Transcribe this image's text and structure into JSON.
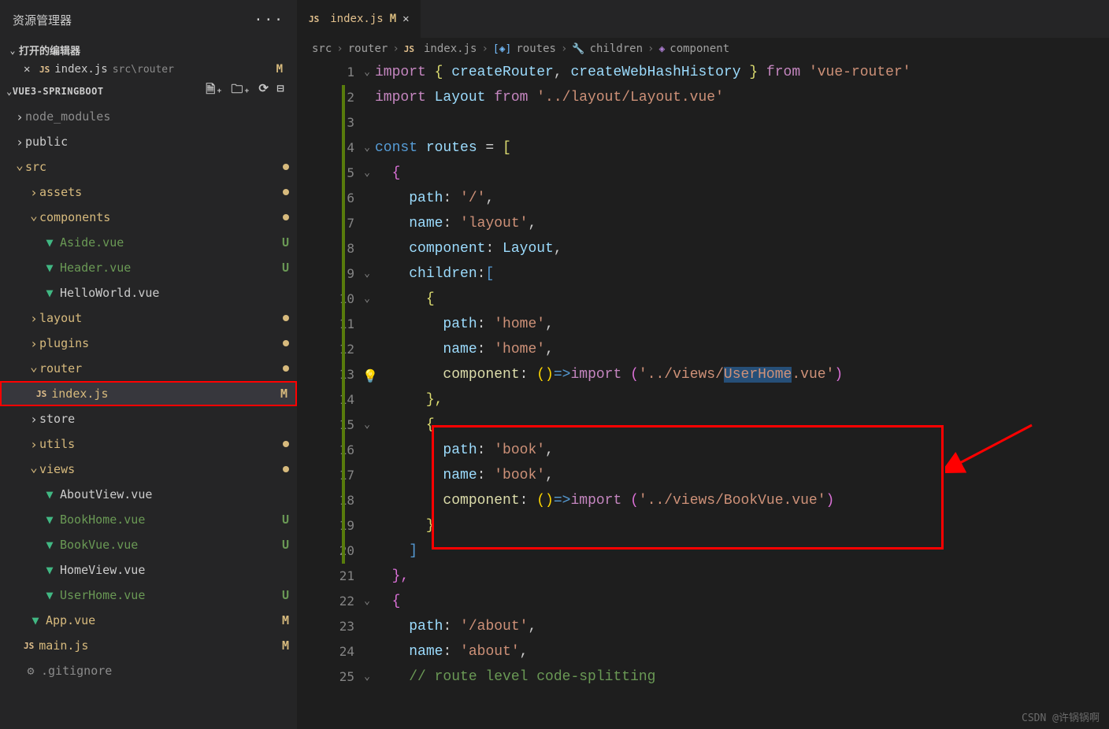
{
  "explorer": {
    "title": "资源管理器",
    "open_editors_label": "打开的编辑器",
    "open_editor_file": "index.js",
    "open_editor_path": "src\\router",
    "open_editor_badge": "M",
    "project_name": "VUE3-SPRINGBOOT"
  },
  "tree": {
    "node_modules": "node_modules",
    "public": "public",
    "src": "src",
    "assets": "assets",
    "components": "components",
    "aside_vue": "Aside.vue",
    "header_vue": "Header.vue",
    "helloworld_vue": "HelloWorld.vue",
    "layout": "layout",
    "plugins": "plugins",
    "router": "router",
    "index_js": "index.js",
    "store": "store",
    "utils": "utils",
    "views": "views",
    "aboutview_vue": "AboutView.vue",
    "bookhome_vue": "BookHome.vue",
    "bookvue_vue": "BookVue.vue",
    "homeview_vue": "HomeView.vue",
    "userhome_vue": "UserHome.vue",
    "app_vue": "App.vue",
    "main_js": "main.js",
    "gitignore": ".gitignore",
    "badge_m": "M",
    "badge_u": "U"
  },
  "tab": {
    "name": "index.js",
    "badge": "M"
  },
  "breadcrumb": {
    "p1": "src",
    "p2": "router",
    "p3": "index.js",
    "p4": "routes",
    "p5": "children",
    "p6": "component"
  },
  "code": {
    "l1a": "import",
    "l1b": "{ ",
    "l1c": "createRouter",
    "l1d": ", ",
    "l1e": "createWebHashHistory",
    "l1f": " }",
    "l1g": " from ",
    "l1h": "'vue-router'",
    "l2a": "import",
    "l2b": " Layout ",
    "l2c": "from ",
    "l2d": "'../layout/Layout.vue'",
    "l4a": "const ",
    "l4b": "routes",
    "l4c": " = ",
    "l4d": "[",
    "l5a": "{",
    "l6a": "path",
    "l6b": ": ",
    "l6c": "'/'",
    "l6d": ",",
    "l7a": "name",
    "l7b": ": ",
    "l7c": "'layout'",
    "l7d": ",",
    "l8a": "component",
    "l8b": ": ",
    "l8c": "Layout",
    "l8d": ",",
    "l9a": "children",
    "l9b": ":",
    "l9c": "[",
    "l10a": "{",
    "l11a": "path",
    "l11b": ": ",
    "l11c": "'home'",
    "l11d": ",",
    "l12a": "name",
    "l12b": ": ",
    "l12c": "'home'",
    "l12d": ",",
    "l13a": "component",
    "l13b": ": ",
    "l13c": "()",
    "l13d": "=>",
    "l13e": "import",
    "l13f": " (",
    "l13g": "'../views/",
    "l13h": "UserHome",
    "l13i": ".vue'",
    "l13j": ")",
    "l14a": "},",
    "l15a": "{",
    "l16a": "path",
    "l16b": ": ",
    "l16c": "'book'",
    "l16d": ",",
    "l17a": "name",
    "l17b": ": ",
    "l17c": "'book'",
    "l17d": ",",
    "l18a": "component",
    "l18b": ": ",
    "l18c": "()",
    "l18d": "=>",
    "l18e": "import",
    "l18f": " (",
    "l18g": "'../views/BookVue.vue'",
    "l18h": ")",
    "l19a": "}",
    "l20a": "]",
    "l21a": "},",
    "l22a": "{",
    "l23a": "path",
    "l23b": ": ",
    "l23c": "'/about'",
    "l23d": ",",
    "l24a": "name",
    "l24b": ": ",
    "l24c": "'about'",
    "l24d": ",",
    "l25a": "// route level code-splitting"
  },
  "watermark": "CSDN @许锅锅啊"
}
